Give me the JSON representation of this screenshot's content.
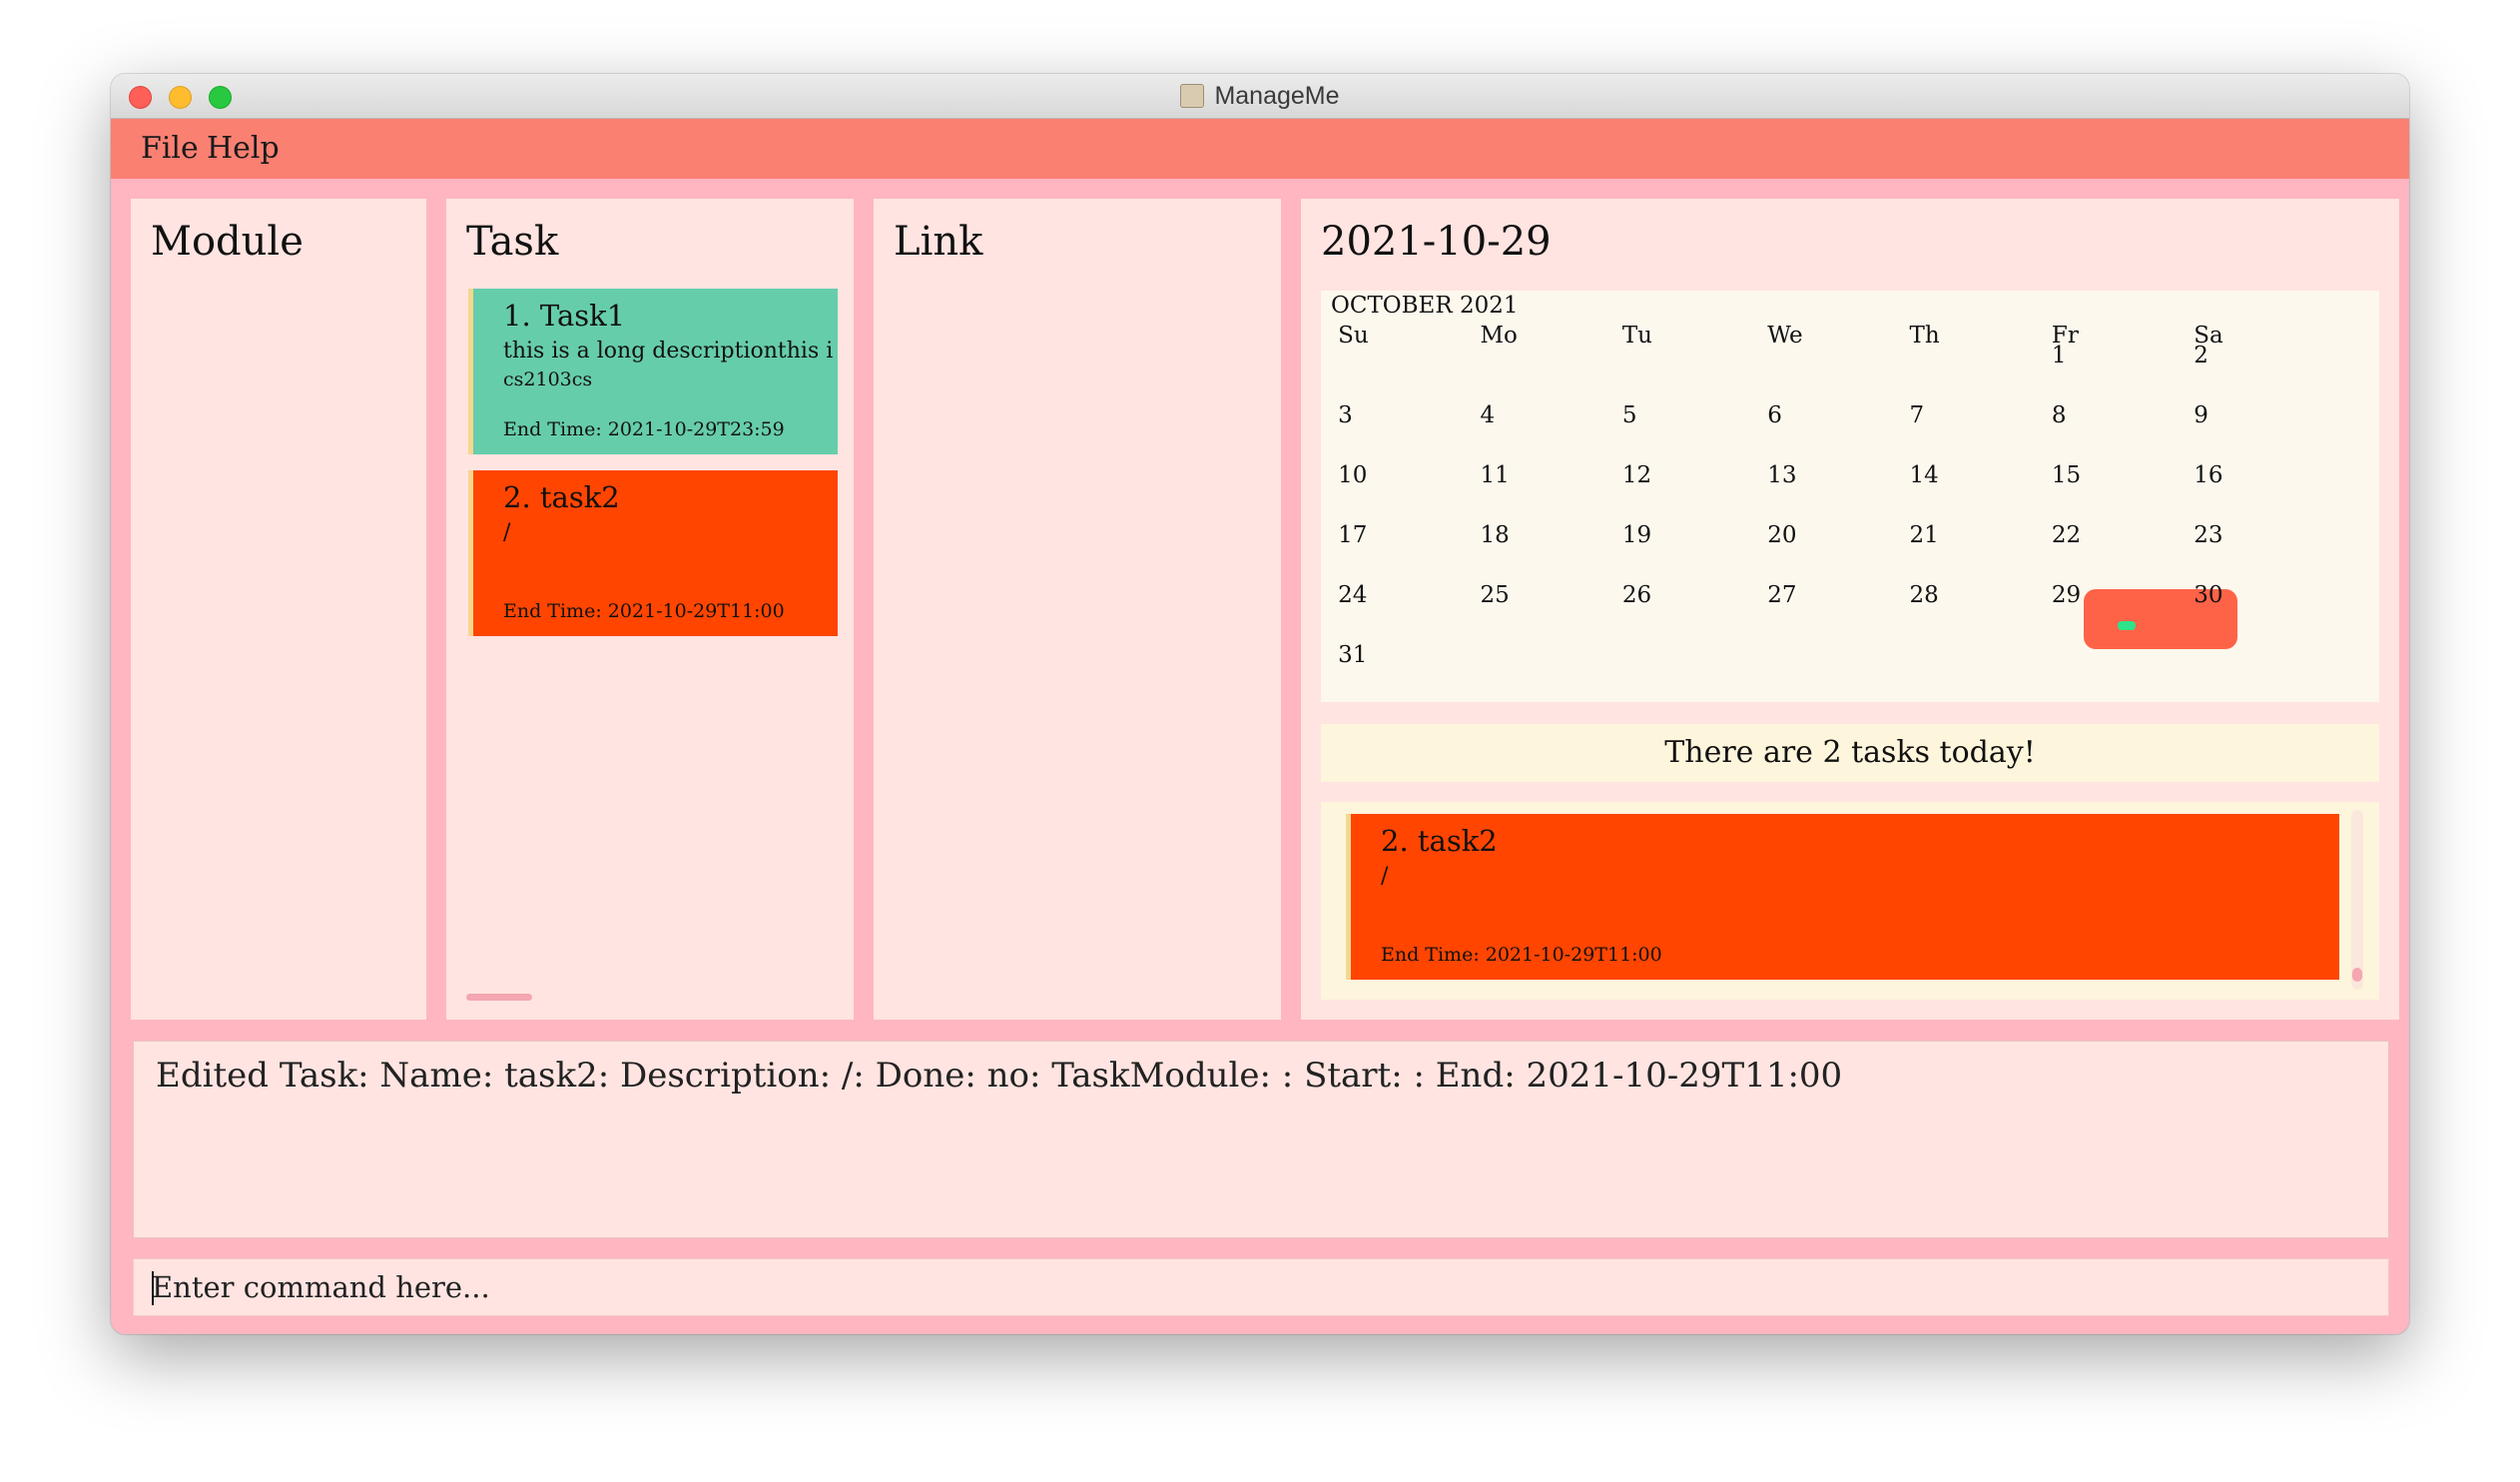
{
  "window": {
    "title": "ManageMe"
  },
  "menu": {
    "items": [
      "File",
      "Help"
    ]
  },
  "panels": {
    "module": {
      "title": "Module"
    },
    "task": {
      "title": "Task",
      "tasks": [
        {
          "title": "1.  Task1",
          "description": "this is a long descriptionthis is a",
          "module": "cs2103cs",
          "end_time": "End Time: 2021-10-29T23:59",
          "color": "#66cdaa"
        },
        {
          "title": "2.  task2",
          "description": "/",
          "module": "",
          "end_time": "End Time: 2021-10-29T11:00",
          "color": "#ff4500"
        }
      ]
    },
    "link": {
      "title": "Link"
    },
    "calendar": {
      "title": "2021-10-29",
      "month_label": "OCTOBER 2021",
      "days_of_week": [
        "Su",
        "Mo",
        "Tu",
        "We",
        "Th",
        "Fr",
        "Sa"
      ],
      "weeks": [
        [
          "",
          "",
          "",
          "",
          "",
          "1",
          "2"
        ],
        [
          "3",
          "4",
          "5",
          "6",
          "7",
          "8",
          "9"
        ],
        [
          "10",
          "11",
          "12",
          "13",
          "14",
          "15",
          "16"
        ],
        [
          "17",
          "18",
          "19",
          "20",
          "21",
          "22",
          "23"
        ],
        [
          "24",
          "25",
          "26",
          "27",
          "28",
          "29",
          "30"
        ],
        [
          "31",
          "",
          "",
          "",
          "",
          "",
          ""
        ]
      ],
      "selected_day": "29",
      "highlight_color": "#ff6347",
      "tasks_today_message": "There are 2 tasks today!",
      "today_tasks": [
        {
          "title": "2.  task2",
          "description": "/",
          "end_time": "End Time: 2021-10-29T11:00"
        }
      ]
    }
  },
  "result": {
    "text": "Edited Task: Name: task2: Description: /: Done: no: TaskModule: : Start: : End: 2021-10-29T11:00"
  },
  "command": {
    "placeholder": "Enter command here..."
  },
  "colors": {
    "menubar": "#fa8072",
    "background": "#ffb6c1",
    "panel": "#ffe4e1",
    "calendar_bg": "#fdf8ee"
  }
}
